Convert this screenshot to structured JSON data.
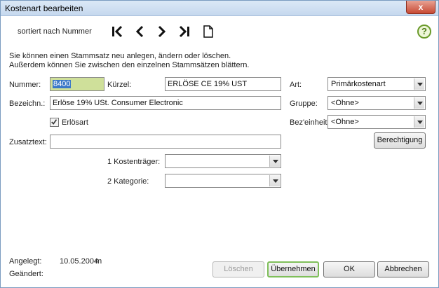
{
  "window": {
    "title": "Kostenart bearbeiten",
    "close_glyph": "x"
  },
  "toolbar": {
    "sort_label": "sortiert nach Nummer",
    "icons": [
      "first-record-icon",
      "previous-record-icon",
      "next-record-icon",
      "last-record-icon",
      "new-document-icon"
    ],
    "help_glyph": "?"
  },
  "info": {
    "line1": "Sie können einen Stammsatz neu anlegen, ändern oder löschen.",
    "line2": "Außerdem können Sie zwischen den einzelnen Stammsätzen blättern."
  },
  "fields": {
    "nummer_label": "Nummer:",
    "nummer_value": "8400",
    "kuerzel_label": "Kürzel:",
    "kuerzel_value": "ERLÖSE CE 19% UST",
    "bezeichnung_label": "Bezeichn.:",
    "bezeichnung_value": "Erlöse 19% USt. Consumer Electronic",
    "erloesart_label": "Erlösart",
    "erloesart_checked": true,
    "zusatztext_label": "Zusatztext:",
    "zusatztext_value": "",
    "kostentraeger_label": "1 Kostenträger:",
    "kostentraeger_value": "",
    "kategorie_label": "2 Kategorie:",
    "kategorie_value": "",
    "art_label": "Art:",
    "art_value": "Primärkostenart",
    "gruppe_label": "Gruppe:",
    "gruppe_value": "<Ohne>",
    "bezeinheit_label": "Bez'einheit:",
    "bezeinheit_value": "<Ohne>"
  },
  "buttons": {
    "berechtigung": "Berechtigung",
    "loeschen": "Löschen",
    "uebernehmen": "Übernehmen",
    "ok": "OK",
    "abbrechen": "Abbrechen"
  },
  "footer": {
    "angelegt_label": "Angelegt:",
    "angelegt_date": "10.05.2004",
    "angelegt_user": "m",
    "geaendert_label": "Geändert:"
  },
  "colors": {
    "nummer_bg": "#cfe09a",
    "selection": "#3a78c8",
    "focus_border": "#7fbf5a",
    "close_button": "#c74a34"
  }
}
